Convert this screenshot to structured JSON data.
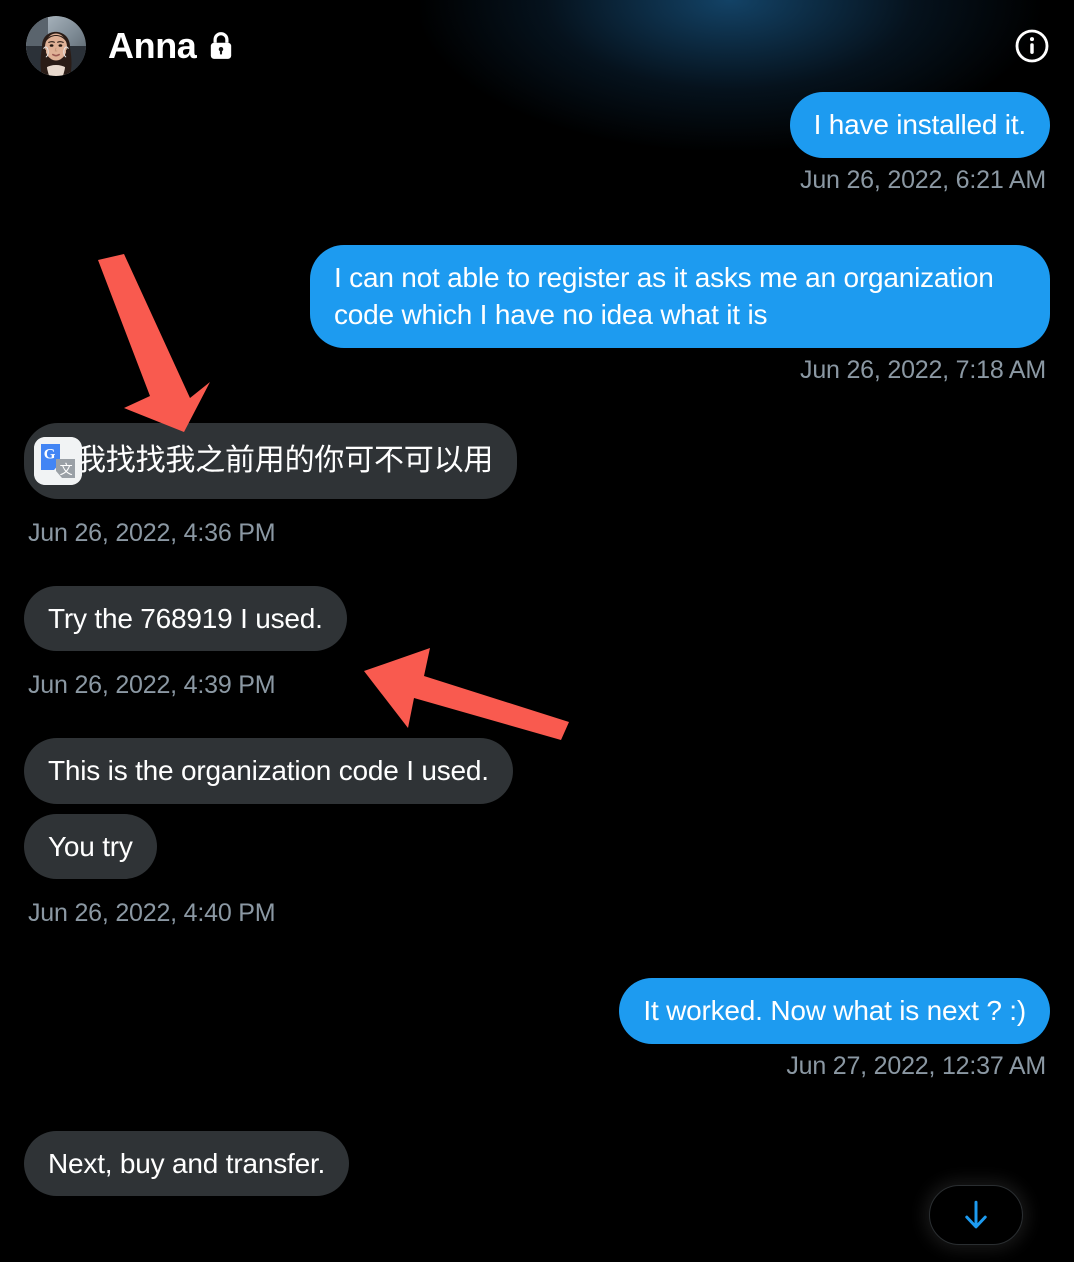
{
  "header": {
    "contact_name": "Anna",
    "lock_icon": "lock-icon",
    "avatar_icon": "avatar-photo",
    "info_icon": "info-circle-icon"
  },
  "colors": {
    "background": "#000000",
    "outgoing_bubble": "#1d9bf0",
    "incoming_bubble": "#2f3336",
    "timestamp_text": "#8b98a3",
    "annotation_arrow": "#f95a4f",
    "scroll_arrow": "#1d9bf0"
  },
  "messages": [
    {
      "id": "m1",
      "direction": "outgoing",
      "text": "I have installed it.",
      "timestamp": "Jun 26, 2022, 6:21 AM"
    },
    {
      "id": "m2",
      "direction": "outgoing",
      "text": "I can not able to register as it asks me an organization code which I have no idea what it is",
      "timestamp": "Jun 26, 2022, 7:18 AM"
    },
    {
      "id": "m3",
      "direction": "incoming",
      "text": "我找找我之前用的你可不可以用",
      "badge": "google-translate-icon",
      "timestamp": "Jun 26, 2022, 4:36 PM"
    },
    {
      "id": "m4",
      "direction": "incoming",
      "text": "Try the 768919 I used.",
      "timestamp": "Jun 26, 2022, 4:39 PM"
    },
    {
      "id": "m5",
      "direction": "incoming",
      "text": "This is the organization code I used.",
      "timestamp": ""
    },
    {
      "id": "m6",
      "direction": "incoming",
      "text": "You try",
      "timestamp": "Jun 26, 2022, 4:40 PM"
    },
    {
      "id": "m7",
      "direction": "outgoing",
      "text": "It worked. Now what is next ? :)",
      "timestamp": "Jun 27, 2022, 12:37 AM"
    },
    {
      "id": "m8",
      "direction": "incoming",
      "text": "Next, buy and transfer.",
      "timestamp": ""
    }
  ],
  "scroll_to_bottom": {
    "icon": "arrow-down-icon"
  },
  "annotations": [
    {
      "id": "a1",
      "type": "arrow",
      "points_to": "translated-message-bubble"
    },
    {
      "id": "a2",
      "type": "arrow",
      "points_to": "organization-code-message-bubble"
    }
  ]
}
